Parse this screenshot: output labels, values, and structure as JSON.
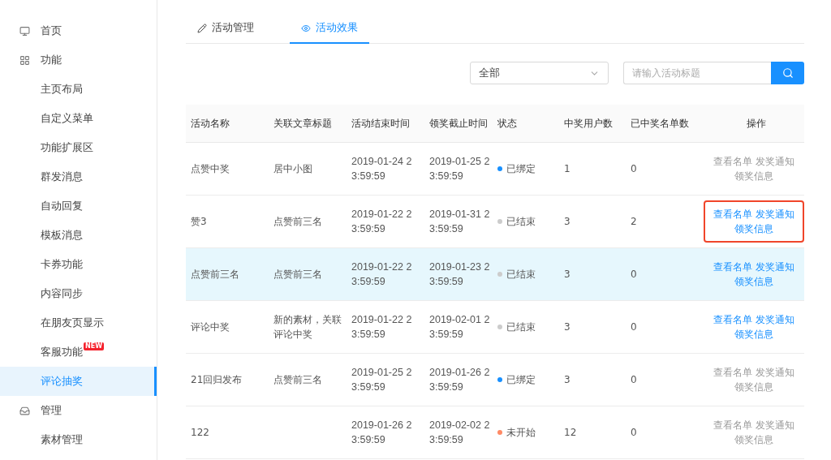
{
  "sidebar": {
    "items": [
      {
        "label": "首页",
        "selected": false
      },
      {
        "label": "功能",
        "selected": false,
        "children": [
          {
            "label": "主页布局",
            "selected": false
          },
          {
            "label": "自定义菜单",
            "selected": false
          },
          {
            "label": "功能扩展区",
            "selected": false
          },
          {
            "label": "群发消息",
            "selected": false
          },
          {
            "label": "自动回复",
            "selected": false
          },
          {
            "label": "模板消息",
            "selected": false
          },
          {
            "label": "卡券功能",
            "selected": false
          },
          {
            "label": "内容同步",
            "selected": false
          },
          {
            "label": "在朋友页显示",
            "selected": false
          },
          {
            "label": "客服功能",
            "badge": "NEW",
            "selected": false
          },
          {
            "label": "评论抽奖",
            "selected": true
          }
        ]
      },
      {
        "label": "管理",
        "selected": false,
        "children": [
          {
            "label": "素材管理",
            "selected": false
          }
        ]
      }
    ]
  },
  "tabs": [
    {
      "label": "活动管理",
      "selected": false
    },
    {
      "label": "活动效果",
      "selected": true
    }
  ],
  "filter": {
    "value": "全部"
  },
  "search": {
    "placeholder": "请输入活动标题"
  },
  "table": {
    "columns": [
      "活动名称",
      "关联文章标题",
      "活动结束时间",
      "领奖截止时间",
      "状态",
      "中奖用户数",
      "已中奖名单数",
      "操作"
    ],
    "rows": [
      {
        "name": "点赞中奖",
        "article": "居中小图",
        "end": "2019-01-24 23:59:59",
        "deadline": "2019-01-25 23:59:59",
        "status": "已绑定",
        "color": "#1890ff",
        "winners": "1",
        "listed": "0",
        "actions": [
          "查看名单",
          "发奖通知",
          "领奖信息"
        ],
        "enabled": false,
        "highlighted": false,
        "annotated": false
      },
      {
        "name": "赞3",
        "article": "点赞前三名",
        "end": "2019-01-22 23:59:59",
        "deadline": "2019-01-31 23:59:59",
        "status": "已结束",
        "color": "#cccccc",
        "winners": "3",
        "listed": "2",
        "actions": [
          "查看名单",
          "发奖通知",
          "领奖信息"
        ],
        "enabled": true,
        "highlighted": false,
        "annotated": true
      },
      {
        "name": "点赞前三名",
        "article": "点赞前三名",
        "end": "2019-01-22 23:59:59",
        "deadline": "2019-01-23 23:59:59",
        "status": "已结束",
        "color": "#cccccc",
        "winners": "3",
        "listed": "0",
        "actions": [
          "查看名单",
          "发奖通知",
          "领奖信息"
        ],
        "enabled": true,
        "highlighted": true,
        "annotated": false
      },
      {
        "name": "评论中奖",
        "article": "新的素材，关联评论中奖",
        "end": "2019-01-22 23:59:59",
        "deadline": "2019-02-01 23:59:59",
        "status": "已结束",
        "color": "#cccccc",
        "winners": "3",
        "listed": "0",
        "actions": [
          "查看名单",
          "发奖通知",
          "领奖信息"
        ],
        "enabled": true,
        "highlighted": false,
        "annotated": false
      },
      {
        "name": "21回归发布",
        "article": "点赞前三名",
        "end": "2019-01-25 23:59:59",
        "deadline": "2019-01-26 23:59:59",
        "status": "已绑定",
        "color": "#1890ff",
        "winners": "3",
        "listed": "0",
        "actions": [
          "查看名单",
          "发奖通知",
          "领奖信息"
        ],
        "enabled": false,
        "highlighted": false,
        "annotated": false
      },
      {
        "name": "122",
        "end": "2019-01-26 23:59:59",
        "deadline": "2019-02-02 23:59:59",
        "status": "未开始",
        "color": "#ff8a65",
        "winners": "12",
        "listed": "0",
        "actions": [
          "查看名单",
          "发奖通知",
          "领奖信息"
        ],
        "enabled": false,
        "highlighted": false,
        "annotated": false
      }
    ]
  }
}
